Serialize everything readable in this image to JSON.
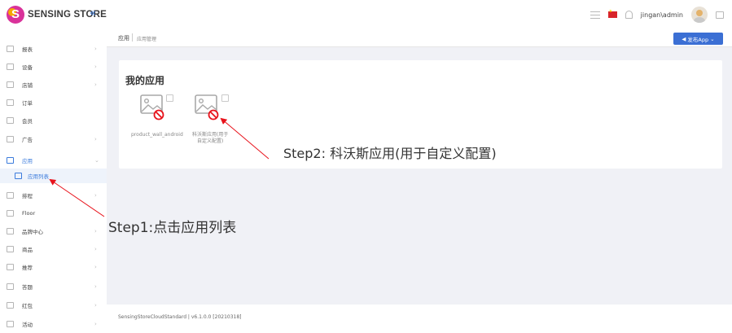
{
  "header": {
    "brand": "SENSING STORE",
    "collapse_icon": "double-chevron-left-icon",
    "user": "jingan\\admin"
  },
  "sidebar": {
    "items": [
      {
        "label": "报表",
        "arrow": "›"
      },
      {
        "label": "设备",
        "arrow": "›"
      },
      {
        "label": "店铺",
        "arrow": "›"
      },
      {
        "label": "订单",
        "arrow": ""
      },
      {
        "label": "会员",
        "arrow": ""
      },
      {
        "label": "广告",
        "arrow": "›"
      },
      {
        "label": "应用",
        "arrow": "⌄",
        "active": true
      },
      {
        "label": "应用列表",
        "sub": true
      },
      {
        "label": "排程",
        "arrow": "›"
      },
      {
        "label": "Floor",
        "arrow": ""
      },
      {
        "label": "品牌中心",
        "arrow": "›"
      },
      {
        "label": "商品",
        "arrow": "›"
      },
      {
        "label": "推荐",
        "arrow": "›"
      },
      {
        "label": "答题",
        "arrow": "›"
      },
      {
        "label": "红包",
        "arrow": "›"
      },
      {
        "label": "活动",
        "arrow": "›"
      }
    ]
  },
  "breadcrumb": {
    "root": "应用",
    "current": "应用管理"
  },
  "publish_button": {
    "label": "发布App",
    "icon": "send-icon",
    "chevron": "⌄"
  },
  "card": {
    "title": "我的应用",
    "apps": [
      {
        "label": "product_wall_android"
      },
      {
        "label": "科沃斯应用(用于\n自定义配置)"
      }
    ]
  },
  "footer": {
    "version": "SensingStoreCloudStandard | v6.1.0.0 [20210318]"
  },
  "annotations": {
    "step1": "Step1:点击应用列表",
    "step2": "Step2:  科沃斯应用(用于自定义配置)"
  },
  "colors": {
    "accent": "#3b6fd4",
    "annotation_arrow": "#e8121b",
    "main_bg": "#f0f1f6"
  }
}
